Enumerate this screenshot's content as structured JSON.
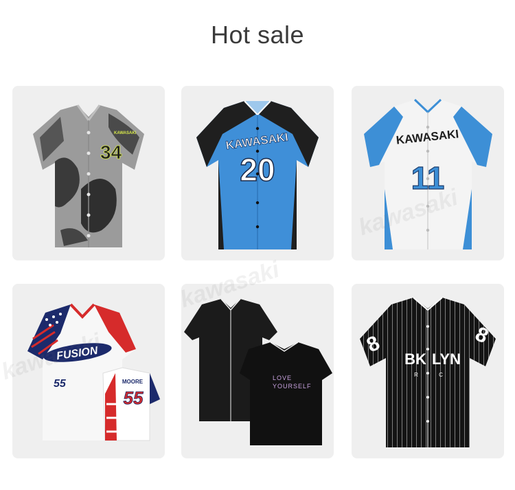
{
  "page": {
    "title": "Hot sale"
  },
  "products": [
    {
      "id": "p1",
      "brand": "KAWASAKI",
      "number": "34"
    },
    {
      "id": "p2",
      "brand": "KAWASAKI",
      "number": "20"
    },
    {
      "id": "p3",
      "brand": "KAWASAKI",
      "number": "11"
    },
    {
      "id": "p4",
      "logo": "FUSION",
      "number": "55",
      "back_name": "MOORE",
      "back_number": "55"
    },
    {
      "id": "p5",
      "back_text_1": "LOVE",
      "back_text_2": "YOURSELF"
    },
    {
      "id": "p6",
      "text_left": "BK",
      "text_right": "LYN",
      "small_left": "R",
      "small_right": "C",
      "sleeve_number": "8"
    }
  ],
  "watermark": "kawasaki",
  "colors": {
    "card_bg": "#efefef",
    "title": "#3a3a3a",
    "blue": "#3d8fd6",
    "sky": "#5ab3e6",
    "red": "#d62b2b",
    "navy": "#1c2a6b"
  }
}
